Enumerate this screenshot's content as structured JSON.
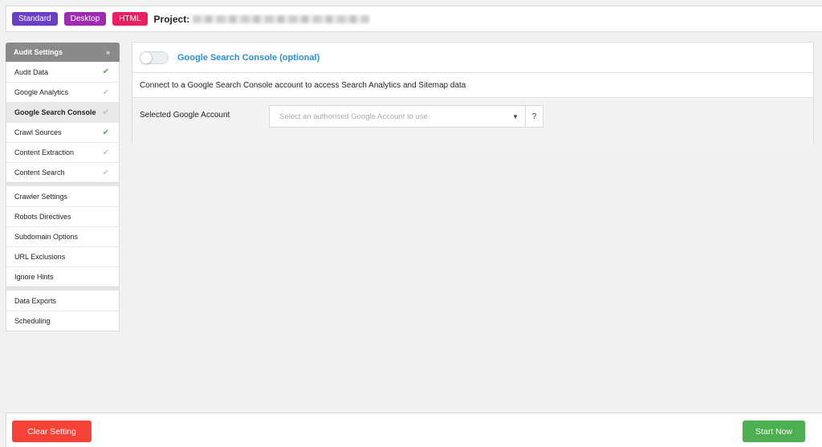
{
  "header": {
    "tags": [
      "Standard",
      "Desktop",
      "HTML"
    ],
    "project_label": "Project:"
  },
  "sidebar": {
    "header": "Audit Settings",
    "groups": [
      [
        {
          "label": "Audit Data",
          "done": true
        },
        {
          "label": "Google Analytics",
          "done": false
        },
        {
          "label": "Google Search Console",
          "done": false,
          "active": true
        },
        {
          "label": "Crawl Sources",
          "done": true
        },
        {
          "label": "Content Extraction",
          "done": false
        },
        {
          "label": "Content Search",
          "done": false
        }
      ],
      [
        {
          "label": "Crawler Settings"
        },
        {
          "label": "Robots Directives"
        },
        {
          "label": "Subdomain Options"
        },
        {
          "label": "URL Exclusions"
        },
        {
          "label": "Ignore Hints"
        }
      ],
      [
        {
          "label": "Data Exports"
        },
        {
          "label": "Scheduling"
        }
      ]
    ]
  },
  "panel": {
    "title": "Google Search Console (optional)",
    "description": "Connect to a Google Search Console account to access Search Analytics and Sitemap data",
    "account_label": "Selected Google Account",
    "account_placeholder": "Select an authorised Google Account to use",
    "help": "?"
  },
  "footer": {
    "clear_label": "Clear Setting",
    "start_label": "Start Now"
  },
  "colors": {
    "standard": "#6a3fc8",
    "desktop": "#9c2bb0",
    "html": "#e91e63",
    "accent": "#2a8fd6",
    "clear": "#f44336",
    "start": "#4caf50"
  },
  "icons": {
    "check": "check-icon",
    "chevron": "chevron-down-icon",
    "caret": "caret-down-icon"
  }
}
